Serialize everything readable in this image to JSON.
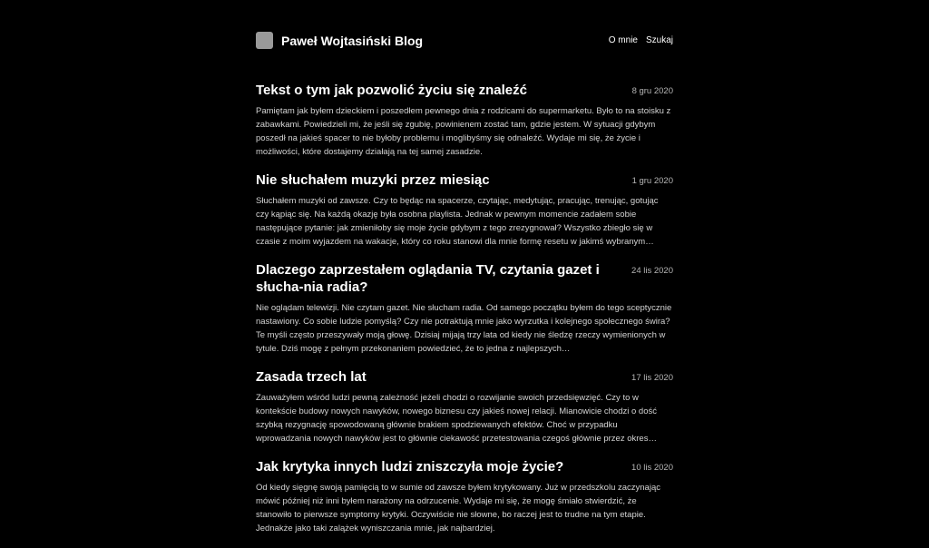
{
  "site": {
    "title": "Paweł Wojtasiński Blog"
  },
  "nav": {
    "items": [
      {
        "label": "O mnie"
      },
      {
        "label": "Szukaj"
      }
    ]
  },
  "colors": {
    "background": "#000000",
    "text": "#ffffff",
    "muted": "#b5b5b5",
    "logo": "#9a9a9a"
  },
  "posts": [
    {
      "title": "Tekst o tym jak pozwolić życiu się znaleźć",
      "date": "8 gru 2020",
      "excerpt": "Pamiętam jak byłem dzieckiem i poszedłem pewnego dnia z rodzicami do supermarketu. Było to na stoisku z zabawkami. Powiedzieli mi, że jeśli się zgubię, powinienem zostać tam, gdzie jestem. W sytuacji gdybym poszedł na jakieś spacer to nie byłoby problemu i moglibyśmy się odnaleźć. Wydaje mi się, że życie i możliwości, które dostajemy działają na tej samej zasadzie."
    },
    {
      "title": "Nie słuchałem muzyki przez miesiąc",
      "date": "1 gru 2020",
      "excerpt": "Słuchałem muzyki od zawsze. Czy to będąc na spacerze, czytając, medytując, pracując, trenując, gotując czy kąpiąc się. Na każdą okazję była osobna playlista. Jednak w pewnym momencie zadałem sobie następujące pytanie: jak zmieniłoby się moje życie gdybym z tego zrezygnował? Wszystko zbiegło się w czasie z moim wyjazdem na wakacje, który co roku stanowi dla mnie formę resetu w jakimś wybranym…"
    },
    {
      "title": "Dlaczego zaprzestałem oglądania TV, czytania gazet i słucha-nia radia?",
      "date": "24 lis 2020",
      "excerpt": "Nie oglądam telewizji. Nie czytam gazet. Nie słucham radia. Od samego początku byłem do tego sceptycznie nastawiony. Co sobie ludzie pomyślą? Czy nie potraktują mnie jako wyrzutka i kolejnego społecznego świra? Te myśli często przeszywały moją głowę. Dzisiaj mijają trzy lata od kiedy nie śledzę rzeczy wymienionych w tytule. Dziś mogę z pełnym przekonaniem powiedzieć, że to jedna z najlepszych…"
    },
    {
      "title": "Zasada trzech lat",
      "date": "17 lis 2020",
      "excerpt": "Zauważyłem wśród ludzi pewną zależność jeżeli chodzi o rozwijanie swoich przedsięwzięć. Czy to w kontekście budowy nowych nawyków, nowego biznesu czy jakieś nowej relacji. Mianowicie chodzi o dość szybką rezygnację spowodowaną głównie brakiem spodziewanych efektów. Choć w przypadku wprowadzania nowych nawyków jest to głównie ciekawość przetestowania czegoś głównie przez okres…"
    },
    {
      "title": "Jak krytyka innych ludzi zniszczyła moje życie?",
      "date": "10 lis 2020",
      "excerpt": "Od kiedy sięgnę swoją pamięcią to w sumie od zawsze byłem krytykowany. Już w przedszkolu zaczynając mówić później niż inni byłem narażony na odrzucenie. Wydaje mi się, że mogę śmiało stwierdzić, że stanowiło to pierwsze symptomy krytyki. Oczywiście nie słowne, bo raczej jest to trudne na tym etapie. Jednakże jako taki zalążek wyniszczania mnie, jak najbardziej."
    }
  ]
}
